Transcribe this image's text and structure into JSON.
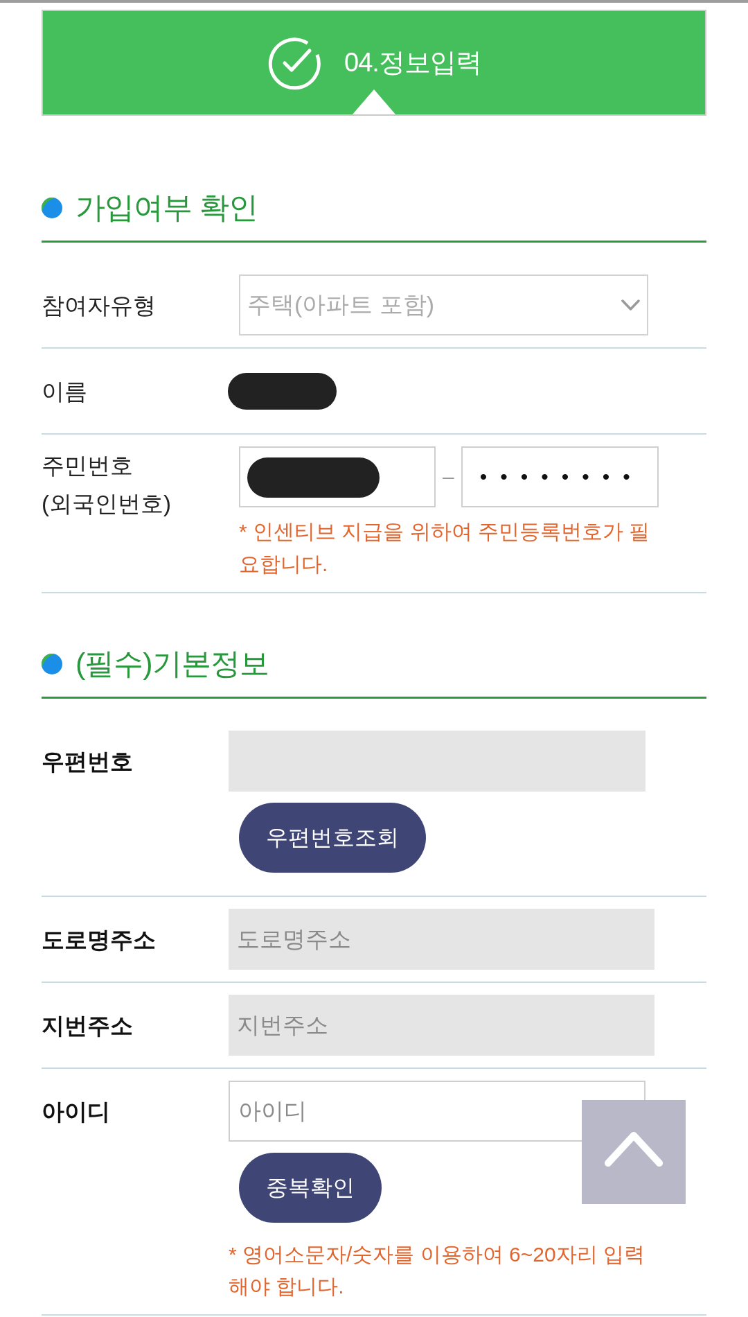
{
  "banner": {
    "step": "04.정보입력"
  },
  "sections": [
    {
      "title": "가입여부 확인",
      "rows": [
        {
          "kind": "select",
          "label": "참여자유형",
          "value": "주택(아파트 포함)",
          "disabled": true
        },
        {
          "kind": "text",
          "label": "이름",
          "redacted": true
        },
        {
          "kind": "split",
          "label": "주민번호 (외국인번호)",
          "first": {
            "redacted": true
          },
          "separator": "–",
          "second": {
            "value": "••••••••"
          },
          "note": "* 인센티브 지급을 위하여 주민등록번호가 필요합니다."
        }
      ]
    },
    {
      "title": "(필수)기본정보",
      "rows": [
        {
          "kind": "readonly",
          "label": "우편번호",
          "button": "우편번호조회"
        },
        {
          "kind": "readonly",
          "label": "도로명주소",
          "placeholder": "도로명주소"
        },
        {
          "kind": "readonly",
          "label": "지번주소",
          "placeholder": "지번주소"
        },
        {
          "kind": "input",
          "label": "아이디",
          "placeholder": "아이디",
          "button": "중복확인",
          "note": "* 영어소문자/숫자를 이용하여 6~20자리 입력해야 합니다."
        }
      ]
    }
  ]
}
